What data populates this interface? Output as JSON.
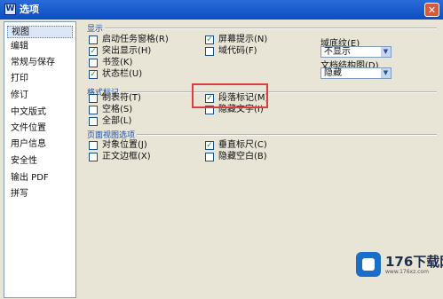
{
  "window": {
    "title": "选项",
    "icon_glyph": "W",
    "close_glyph": "✕"
  },
  "sidebar": {
    "items": [
      {
        "label": "视图",
        "selected": true
      },
      {
        "label": "编辑"
      },
      {
        "label": "常规与保存"
      },
      {
        "label": "打印"
      },
      {
        "label": "修订"
      },
      {
        "label": "中文版式"
      },
      {
        "label": "文件位置"
      },
      {
        "label": "用户信息"
      },
      {
        "label": "安全性"
      },
      {
        "label": "输出 PDF"
      },
      {
        "label": "拼写"
      }
    ]
  },
  "display": {
    "group_label": "显示",
    "options": [
      {
        "label": "启动任务窗格(R)",
        "checked": false
      },
      {
        "label": "屏幕提示(N)",
        "checked": true
      },
      {
        "label": "突出显示(H)",
        "checked": true
      },
      {
        "label": "域代码(F)",
        "checked": false
      },
      {
        "label": "书签(K)",
        "checked": false
      },
      {
        "label": "状态栏(U)",
        "checked": true
      }
    ],
    "field_shading_label": "域底纹(E)",
    "field_shading_value": "不显示",
    "doc_map_label": "文档结构图(D)",
    "doc_map_value": "隐藏"
  },
  "formatting": {
    "group_label": "格式标记",
    "options": [
      {
        "label": "制表符(T)",
        "checked": false
      },
      {
        "label": "段落标记(M)",
        "checked": true
      },
      {
        "label": "空格(S)",
        "checked": false
      },
      {
        "label": "隐藏文字(I)",
        "checked": false
      },
      {
        "label": "全部(L)",
        "checked": false
      }
    ]
  },
  "page_view": {
    "group_label": "页面视图选项",
    "options": [
      {
        "label": "对象位置(J)",
        "checked": false
      },
      {
        "label": "垂直标尺(C)",
        "checked": true
      },
      {
        "label": "正文边框(X)",
        "checked": false
      },
      {
        "label": "隐藏空白(B)",
        "checked": false
      }
    ]
  },
  "watermark": {
    "brand": "176下载网",
    "url": "www.176xz.com"
  },
  "colors": {
    "titlebar": "#0a4ec3",
    "highlight_box": "#d84040",
    "group_label": "#1e4fa8"
  }
}
